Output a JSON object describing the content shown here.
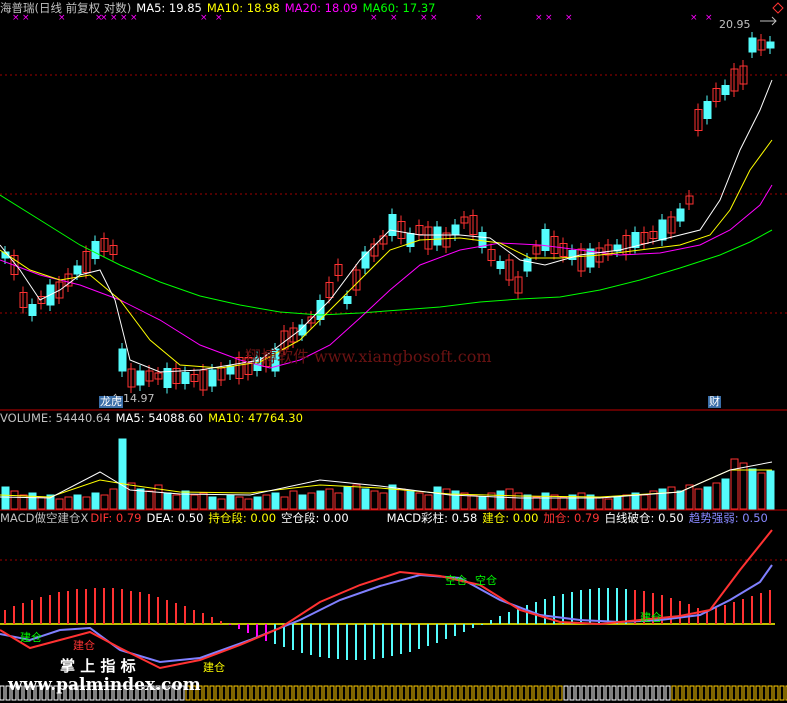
{
  "price_header": {
    "title": "海普瑞(日线 前复权 对数)",
    "ma5": "MA5: 19.85",
    "ma10": "MA10: 18.98",
    "ma20": "MA20: 18.09",
    "ma60": "MA60: 17.37"
  },
  "price_panel": {
    "high_label": "20.95",
    "low_label": "14.97",
    "tag_left": "龙虎",
    "tag_right": "财",
    "watermark": "翔博软件 www.xiangbosoft.com"
  },
  "volume_header": {
    "volume": "VOLUME: 54440.64",
    "ma5": "MA5: 54088.60",
    "ma10": "MA10: 47764.30"
  },
  "macd_header": {
    "title": "MACD做空建仓X",
    "dif": "DIF: 0.79",
    "dea": "DEA: 0.50",
    "hold": "持仓段: 0.00",
    "empty": "空仓段: 0.00",
    "bar": "MACD彩柱: 0.58",
    "build": "建仓: 0.00",
    "add": "加仓: 0.79",
    "whiteline": "白线破仓: 0.50",
    "trend": "趋势强弱: 0.50"
  },
  "macd_panel": {
    "label_1": "建仓",
    "label_2": "建仓",
    "label_3": "建仓",
    "label_4": "空仓",
    "label_5": "空仓",
    "label_6": "建仓",
    "watermark_cn": "掌 上 指 标",
    "watermark_url": "www.palmindex.com"
  },
  "colors": {
    "background": "#000000",
    "up": "#ff3232",
    "down": "#54fcfc",
    "ma5": "#ffffff",
    "ma10": "#ffff00",
    "ma20": "#ff00ff",
    "ma60": "#00ff00",
    "grid": "#a00000",
    "dea": "#8080ff"
  }
}
